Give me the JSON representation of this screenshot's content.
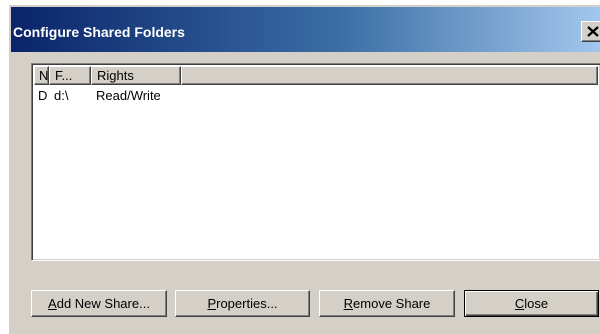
{
  "window": {
    "title": "Configure Shared Folders"
  },
  "list": {
    "columns": [
      "N",
      "F...",
      "Rights"
    ],
    "rows": [
      {
        "name": "D",
        "folder": "d:\\",
        "rights": "Read/Write"
      }
    ]
  },
  "buttons": {
    "add": {
      "accel": "A",
      "rest": "dd New Share..."
    },
    "properties": {
      "accel": "P",
      "rest": "roperties..."
    },
    "remove": {
      "accel": "R",
      "rest": "emove Share"
    },
    "close": {
      "accel": "C",
      "rest": "lose"
    }
  },
  "icons": {
    "close": "close-x-icon"
  },
  "colors": {
    "titlebar_start": "#0a246a",
    "titlebar_end": "#a6caf0",
    "dialog_face": "#d4d0c8"
  }
}
